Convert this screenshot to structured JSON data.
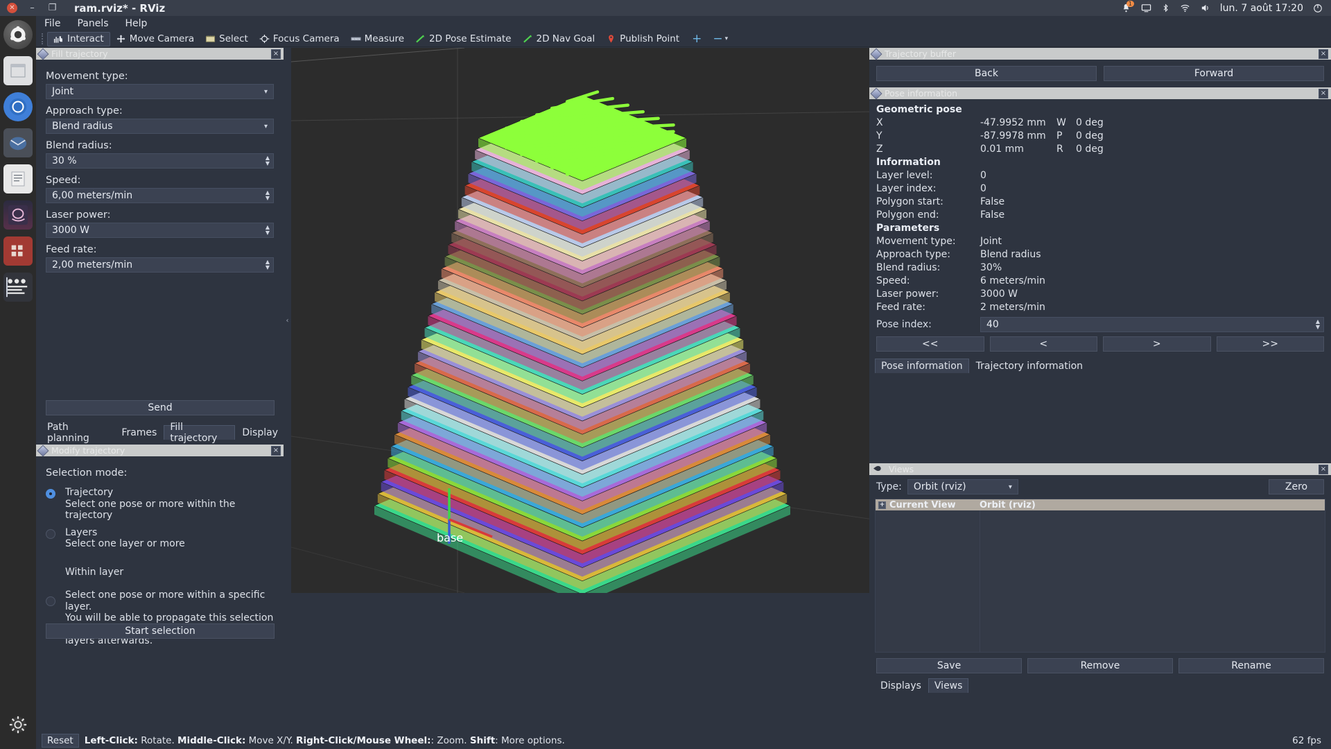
{
  "window": {
    "title": "ram.rviz* - RViz",
    "close_icon": "close-icon",
    "minimize_icon": "minimize-icon",
    "maximize_icon": "maximize-icon"
  },
  "tray": {
    "clock": "lun. 7 août 17:20",
    "items": [
      "notification-icon",
      "screen-icon",
      "bluetooth-icon",
      "network-icon",
      "volume-icon",
      "power-icon"
    ],
    "badge": "1"
  },
  "menubar": {
    "items": [
      "File",
      "Panels",
      "Help"
    ]
  },
  "toolbar": {
    "items": [
      {
        "label": "Interact",
        "icon": "interact-icon",
        "active": true
      },
      {
        "label": "Move Camera",
        "icon": "move-camera-icon",
        "active": false
      },
      {
        "label": "Select",
        "icon": "select-icon",
        "active": false
      },
      {
        "label": "Focus Camera",
        "icon": "focus-camera-icon",
        "active": false
      },
      {
        "label": "Measure",
        "icon": "measure-icon",
        "active": false
      },
      {
        "label": "2D Pose Estimate",
        "icon": "pose-estimate-icon",
        "active": false
      },
      {
        "label": "2D Nav Goal",
        "icon": "nav-goal-icon",
        "active": false
      },
      {
        "label": "Publish Point",
        "icon": "publish-point-icon",
        "active": false
      }
    ],
    "add_label": "+",
    "remove_label": "−"
  },
  "dock": {
    "items": [
      "ubuntu-icon",
      "files-icon",
      "firefox-icon",
      "thunderbird-icon",
      "text-editor-icon",
      "amazon-icon",
      "redmine-icon",
      "rviz-icon",
      "settings-icon"
    ]
  },
  "fill_trajectory": {
    "panel_title": "Fill trajectory",
    "close_label": "×",
    "fields": [
      {
        "label": "Movement type:",
        "value": "Joint",
        "kind": "combo"
      },
      {
        "label": "Approach type:",
        "value": "Blend radius",
        "kind": "combo"
      },
      {
        "label": "Blend radius:",
        "value": "30 %",
        "kind": "spin"
      },
      {
        "label": "Speed:",
        "value": "6,00 meters/min",
        "kind": "spin"
      },
      {
        "label": "Laser power:",
        "value": "3000 W",
        "kind": "spin"
      },
      {
        "label": "Feed rate:",
        "value": "2,00 meters/min",
        "kind": "spin"
      }
    ],
    "send_label": "Send"
  },
  "left_tabs": {
    "items": [
      "Path planning",
      "Frames",
      "Fill trajectory",
      "Display"
    ],
    "selected": "Fill trajectory"
  },
  "modify_trajectory": {
    "panel_title": "Modify trajectory",
    "close_label": "×",
    "selection_mode_label": "Selection mode:",
    "options": [
      {
        "title": "Trajectory",
        "desc": "Select one pose or more within the trajectory",
        "selected": true
      },
      {
        "title": "Layers",
        "desc": "Select one layer or more",
        "selected": false
      },
      {
        "title": "Within layer",
        "desc": "Select one pose or more within a specific layer.\nYou will be able to propagate this selection across\nlayers afterwards.",
        "selected": false
      }
    ],
    "start_selection_label": "Start selection"
  },
  "trajectory_buffer": {
    "panel_title": "Trajectory buffer",
    "close_label": "×",
    "back_label": "Back",
    "forward_label": "Forward"
  },
  "pose_information": {
    "panel_title": "Pose information",
    "close_label": "×",
    "geometric_pose_header": "Geometric pose",
    "geometric_rows": [
      {
        "axis": "X",
        "value": "-47.9952 mm",
        "rot_key": "W",
        "rot_value": "0 deg"
      },
      {
        "axis": "Y",
        "value": "-87.9978 mm",
        "rot_key": "P",
        "rot_value": "0 deg"
      },
      {
        "axis": "Z",
        "value": "0.01 mm",
        "rot_key": "R",
        "rot_value": "0 deg"
      }
    ],
    "information_header": "Information",
    "information_rows": [
      {
        "key": "Layer level:",
        "value": "0"
      },
      {
        "key": "Layer index:",
        "value": "0"
      },
      {
        "key": "Polygon start:",
        "value": "False"
      },
      {
        "key": "Polygon end:",
        "value": "False"
      }
    ],
    "parameters_header": "Parameters",
    "parameter_rows": [
      {
        "key": "Movement type:",
        "value": "Joint"
      },
      {
        "key": "Approach type:",
        "value": "Blend radius"
      },
      {
        "key": "Blend radius:",
        "value": "30%"
      },
      {
        "key": "Speed:",
        "value": "6 meters/min"
      },
      {
        "key": "Laser power:",
        "value": "3000 W"
      },
      {
        "key": "Feed rate:",
        "value": "2 meters/min"
      }
    ],
    "pose_index_label": "Pose index:",
    "pose_index_value": "40",
    "nav_buttons": [
      "<<",
      "<",
      ">",
      ">>"
    ]
  },
  "right_tabs": {
    "items": [
      "Pose information",
      "Trajectory information"
    ],
    "selected": "Pose information"
  },
  "views": {
    "panel_title": "Views",
    "close_label": "×",
    "type_label": "Type:",
    "type_value": "Orbit (rviz)",
    "zero_label": "Zero",
    "list_headers": [
      "Current View",
      "Orbit (rviz)"
    ],
    "expand_label": "+",
    "buttons": [
      "Save",
      "Remove",
      "Rename"
    ],
    "tabs": [
      "Displays",
      "Views"
    ],
    "selected_tab": "Views"
  },
  "statusbar": {
    "reset_label": "Reset",
    "hints": [
      {
        "bold": "Left-Click:",
        "text": " Rotate. "
      },
      {
        "bold": "Middle-Click:",
        "text": " Move X/Y. "
      },
      {
        "bold": "Right-Click/Mouse Wheel:",
        "text": ": Zoom. "
      },
      {
        "bold": "Shift",
        "text": ": More options."
      }
    ],
    "fps": "62 fps"
  },
  "scene": {
    "base_frame_label": "base",
    "layer_colors": [
      "#8dff3a",
      "#e6b2d8",
      "#39c0b8",
      "#7a66d8",
      "#d8452e",
      "#b8c9e8",
      "#e8e0a8",
      "#c77fc0",
      "#8e6f5a",
      "#9c3a52",
      "#7a8f4a",
      "#e8886a",
      "#c8bfa8",
      "#e8c86a",
      "#6a9fd8",
      "#d83a8a",
      "#4ad8b8",
      "#e8e86a",
      "#9a8fd8",
      "#d86a4a",
      "#6ad86a",
      "#4a5fd8",
      "#d8d8d8",
      "#5ad8d8",
      "#a86ad8",
      "#d88a3a",
      "#3aa8d8",
      "#8ad83a",
      "#d83a3a",
      "#6a4ad8",
      "#d8b83a",
      "#3ad88a"
    ]
  }
}
